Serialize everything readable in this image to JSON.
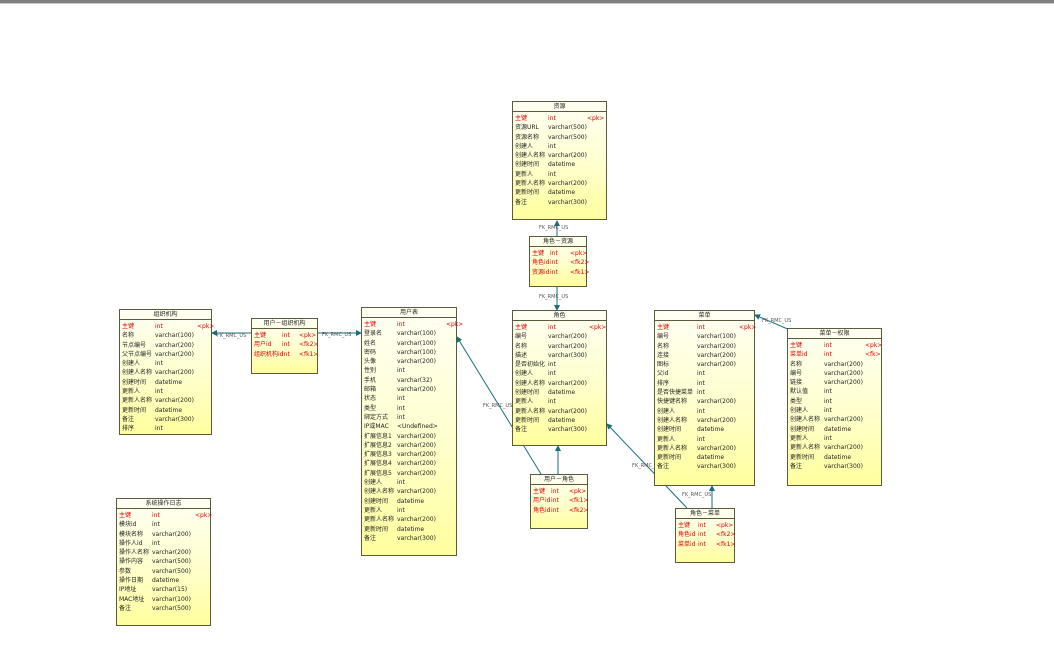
{
  "relations": [
    "FK_RMC_US",
    "FK_RMC_US",
    "FK_RMC_US",
    "FK_RMC_US",
    "FK_RMC_US",
    "FK_RMC_US",
    "FK_RMC_US",
    "FK_RMC_US"
  ],
  "tables": {
    "ziyuan": {
      "title": "资源",
      "rows": [
        {
          "name": "主键",
          "type": "int",
          "key": "<pk>",
          "pk": true
        },
        {
          "name": "资源URL",
          "type": "varchar(500)",
          "key": ""
        },
        {
          "name": "资源名称",
          "type": "varchar(500)",
          "key": ""
        },
        {
          "name": "创建人",
          "type": "int",
          "key": ""
        },
        {
          "name": "创建人名称",
          "type": "varchar(200)",
          "key": ""
        },
        {
          "name": "创建时间",
          "type": "datetime",
          "key": ""
        },
        {
          "name": "更新人",
          "type": "int",
          "key": ""
        },
        {
          "name": "更新人名称",
          "type": "varchar(200)",
          "key": ""
        },
        {
          "name": "更新时间",
          "type": "datetime",
          "key": ""
        },
        {
          "name": "备注",
          "type": "varchar(300)",
          "key": ""
        }
      ]
    },
    "juese_ziyuan": {
      "title": "角色－资源",
      "rows": [
        {
          "name": "主键",
          "type": "int",
          "key": "<pk>",
          "pk": true
        },
        {
          "name": "角色id",
          "type": "int",
          "key": "<fk2>",
          "pk": true
        },
        {
          "name": "资源id",
          "type": "int",
          "key": "<fk1>",
          "pk": true
        }
      ]
    },
    "zuzhijigou": {
      "title": "组织机构",
      "rows": [
        {
          "name": "主键",
          "type": "int",
          "key": "<pk>",
          "pk": true
        },
        {
          "name": "名称",
          "type": "varchar(100)",
          "key": ""
        },
        {
          "name": "节点编号",
          "type": "varchar(200)",
          "key": ""
        },
        {
          "name": "父节点编号",
          "type": "varchar(200)",
          "key": ""
        },
        {
          "name": "创建人",
          "type": "int",
          "key": ""
        },
        {
          "name": "创建人名称",
          "type": "varchar(200)",
          "key": ""
        },
        {
          "name": "创建时间",
          "type": "datetime",
          "key": ""
        },
        {
          "name": "更新人",
          "type": "int",
          "key": ""
        },
        {
          "name": "更新人名称",
          "type": "varchar(200)",
          "key": ""
        },
        {
          "name": "更新时间",
          "type": "datetime",
          "key": ""
        },
        {
          "name": "备注",
          "type": "varchar(300)",
          "key": ""
        },
        {
          "name": "排序",
          "type": "int",
          "key": ""
        }
      ]
    },
    "yonghu_zuzhi": {
      "title": "用户－组织机构",
      "rows": [
        {
          "name": "主键",
          "type": "int",
          "key": "<pk>",
          "pk": true
        },
        {
          "name": "用户id",
          "type": "int",
          "key": "<fk2>",
          "pk": true
        },
        {
          "name": "组织机构id",
          "type": "int",
          "key": "<fk1>",
          "pk": true
        }
      ]
    },
    "yonghubiao": {
      "title": "用户表",
      "rows": [
        {
          "name": "主键",
          "type": "int",
          "key": "<pk>",
          "pk": true
        },
        {
          "name": "登录名",
          "type": "varchar(100)",
          "key": ""
        },
        {
          "name": "姓名",
          "type": "varchar(100)",
          "key": ""
        },
        {
          "name": "密码",
          "type": "varchar(100)",
          "key": ""
        },
        {
          "name": "头像",
          "type": "varchar(200)",
          "key": ""
        },
        {
          "name": "性别",
          "type": "int",
          "key": ""
        },
        {
          "name": "手机",
          "type": "varchar(32)",
          "key": ""
        },
        {
          "name": "邮箱",
          "type": "varchar(200)",
          "key": ""
        },
        {
          "name": "状态",
          "type": "int",
          "key": ""
        },
        {
          "name": "类型",
          "type": "int",
          "key": ""
        },
        {
          "name": "绑定方式",
          "type": "int",
          "key": ""
        },
        {
          "name": "IP或MAC",
          "type": "<Undefined>",
          "key": ""
        },
        {
          "name": "扩展信息1",
          "type": "varchar(200)",
          "key": ""
        },
        {
          "name": "扩展信息2",
          "type": "varchar(200)",
          "key": ""
        },
        {
          "name": "扩展信息3",
          "type": "varchar(200)",
          "key": ""
        },
        {
          "name": "扩展信息4",
          "type": "varchar(200)",
          "key": ""
        },
        {
          "name": "扩展信息5",
          "type": "varchar(200)",
          "key": ""
        },
        {
          "name": "创建人",
          "type": "int",
          "key": ""
        },
        {
          "name": "创建人名称",
          "type": "varchar(200)",
          "key": ""
        },
        {
          "name": "创建时间",
          "type": "datetime",
          "key": ""
        },
        {
          "name": "更新人",
          "type": "int",
          "key": ""
        },
        {
          "name": "更新人名称",
          "type": "varchar(200)",
          "key": ""
        },
        {
          "name": "更新时间",
          "type": "datetime",
          "key": ""
        },
        {
          "name": "备注",
          "type": "varchar(300)",
          "key": ""
        }
      ]
    },
    "juese": {
      "title": "角色",
      "rows": [
        {
          "name": "主键",
          "type": "int",
          "key": "<pk>",
          "pk": true
        },
        {
          "name": "编号",
          "type": "varchar(200)",
          "key": ""
        },
        {
          "name": "名称",
          "type": "varchar(200)",
          "key": ""
        },
        {
          "name": "描述",
          "type": "varchar(300)",
          "key": ""
        },
        {
          "name": "是否初始化",
          "type": "int",
          "key": ""
        },
        {
          "name": "创建人",
          "type": "int",
          "key": ""
        },
        {
          "name": "创建人名称",
          "type": "varchar(200)",
          "key": ""
        },
        {
          "name": "创建时间",
          "type": "datetime",
          "key": ""
        },
        {
          "name": "更新人",
          "type": "int",
          "key": ""
        },
        {
          "name": "更新人名称",
          "type": "varchar(200)",
          "key": ""
        },
        {
          "name": "更新时间",
          "type": "datetime",
          "key": ""
        },
        {
          "name": "备注",
          "type": "varchar(300)",
          "key": ""
        }
      ]
    },
    "yonghu_juese": {
      "title": "用户－角色",
      "rows": [
        {
          "name": "主键",
          "type": "int",
          "key": "<pk>",
          "pk": true
        },
        {
          "name": "用户id",
          "type": "int",
          "key": "<fk1>",
          "pk": true
        },
        {
          "name": "角色id",
          "type": "int",
          "key": "<fk2>",
          "pk": true
        }
      ]
    },
    "caidan": {
      "title": "菜单",
      "rows": [
        {
          "name": "主键",
          "type": "int",
          "key": "<pk>",
          "pk": true
        },
        {
          "name": "编号",
          "type": "varchar(100)",
          "key": ""
        },
        {
          "name": "名称",
          "type": "varchar(200)",
          "key": ""
        },
        {
          "name": "连接",
          "type": "varchar(200)",
          "key": ""
        },
        {
          "name": "图标",
          "type": "varchar(200)",
          "key": ""
        },
        {
          "name": "父id",
          "type": "int",
          "key": ""
        },
        {
          "name": "排序",
          "type": "int",
          "key": ""
        },
        {
          "name": "是否快捷菜单",
          "type": "int",
          "key": ""
        },
        {
          "name": "快捷键名称",
          "type": "varchar(200)",
          "key": ""
        },
        {
          "name": "创建人",
          "type": "int",
          "key": ""
        },
        {
          "name": "创建人名称",
          "type": "varchar(200)",
          "key": ""
        },
        {
          "name": "创建时间",
          "type": "datetime",
          "key": ""
        },
        {
          "name": "更新人",
          "type": "int",
          "key": ""
        },
        {
          "name": "更新人名称",
          "type": "varchar(200)",
          "key": ""
        },
        {
          "name": "更新时间",
          "type": "datetime",
          "key": ""
        },
        {
          "name": "备注",
          "type": "varchar(300)",
          "key": ""
        }
      ]
    },
    "caidan_quanxian": {
      "title": "菜单－权限",
      "rows": [
        {
          "name": "主键",
          "type": "int",
          "key": "<pk>",
          "pk": true
        },
        {
          "name": "菜单id",
          "type": "int",
          "key": "<fk>",
          "pk": true
        },
        {
          "name": "名称",
          "type": "varchar(200)",
          "key": ""
        },
        {
          "name": "编号",
          "type": "varchar(200)",
          "key": ""
        },
        {
          "name": "链接",
          "type": "varchar(200)",
          "key": ""
        },
        {
          "name": "默认值",
          "type": "int",
          "key": ""
        },
        {
          "name": "类型",
          "type": "int",
          "key": ""
        },
        {
          "name": "创建人",
          "type": "int",
          "key": ""
        },
        {
          "name": "创建人名称",
          "type": "varchar(200)",
          "key": ""
        },
        {
          "name": "创建时间",
          "type": "datetime",
          "key": ""
        },
        {
          "name": "更新人",
          "type": "int",
          "key": ""
        },
        {
          "name": "更新人名称",
          "type": "varchar(200)",
          "key": ""
        },
        {
          "name": "更新时间",
          "type": "datetime",
          "key": ""
        },
        {
          "name": "备注",
          "type": "varchar(300)",
          "key": ""
        }
      ]
    },
    "juese_caidan": {
      "title": "角色－菜单",
      "rows": [
        {
          "name": "主键",
          "type": "int",
          "key": "<pk>",
          "pk": true
        },
        {
          "name": "角色id",
          "type": "int",
          "key": "<fk2>",
          "pk": true
        },
        {
          "name": "菜单id",
          "type": "int",
          "key": "<fk1>",
          "pk": true
        }
      ]
    },
    "xitongrizhi": {
      "title": "系统操作日志",
      "rows": [
        {
          "name": "主键",
          "type": "int",
          "key": "<pk>",
          "pk": true
        },
        {
          "name": "模块id",
          "type": "int",
          "key": ""
        },
        {
          "name": "模块名称",
          "type": "varchar(200)",
          "key": ""
        },
        {
          "name": "操作人id",
          "type": "int",
          "key": ""
        },
        {
          "name": "操作人名称",
          "type": "varchar(200)",
          "key": ""
        },
        {
          "name": "操作内容",
          "type": "varchar(500)",
          "key": ""
        },
        {
          "name": "参数",
          "type": "varchar(500)",
          "key": ""
        },
        {
          "name": "操作日期",
          "type": "datetime",
          "key": ""
        },
        {
          "name": "IP地址",
          "type": "varchar(15)",
          "key": ""
        },
        {
          "name": "MAC地址",
          "type": "varchar(100)",
          "key": ""
        },
        {
          "name": "备注",
          "type": "varchar(500)",
          "key": ""
        }
      ]
    }
  }
}
